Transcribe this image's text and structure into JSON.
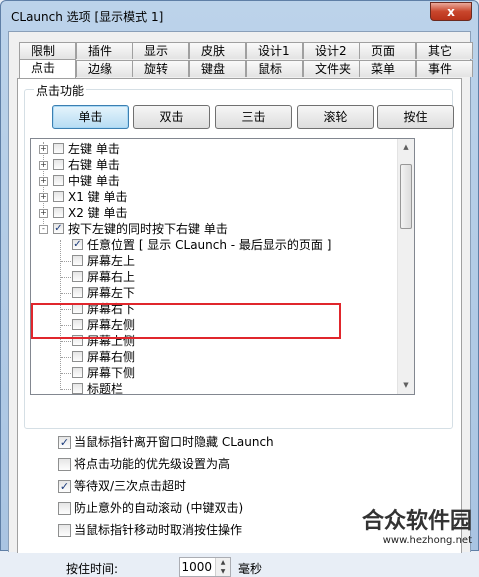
{
  "window": {
    "title": "CLaunch 选项 [显示模式 1]",
    "close_label": "x"
  },
  "tabs_row1": [
    "限制",
    "插件",
    "显示",
    "皮肤",
    "设计1",
    "设计2",
    "页面",
    "其它"
  ],
  "tabs_row2": [
    "点击",
    "边缘",
    "旋转",
    "键盘",
    "鼠标",
    "文件夹",
    "菜单",
    "事件"
  ],
  "active_tab": "点击",
  "group": {
    "label": "点击功能",
    "buttons": [
      "单击",
      "双击",
      "三击",
      "滚轮",
      "按住"
    ],
    "selected_button": "单击"
  },
  "tree": {
    "items": [
      {
        "label": "左键 单击",
        "checked": false,
        "expander": "+"
      },
      {
        "label": "右键 单击",
        "checked": false,
        "expander": "+"
      },
      {
        "label": "中键 单击",
        "checked": false,
        "expander": "+"
      },
      {
        "label": "X1 键 单击",
        "checked": false,
        "expander": "+"
      },
      {
        "label": "X2 键 单击",
        "checked": false,
        "expander": "+"
      },
      {
        "label": "按下左键的同时按下右键 单击",
        "checked": true,
        "expander": "-"
      }
    ],
    "sub_selected": {
      "label": "任意位置 [ 显示 CLaunch - 最后显示的页面 ]",
      "checked": true
    },
    "sub_items": [
      "屏幕左上",
      "屏幕右上",
      "屏幕左下",
      "屏幕右下",
      "屏幕左侧",
      "屏幕上侧",
      "屏幕右侧",
      "屏幕下侧",
      "标题栏"
    ]
  },
  "options": [
    {
      "label": "当鼠标指针离开窗口时隐藏 CLaunch",
      "checked": true
    },
    {
      "label": "将点击功能的优先级设置为高",
      "checked": false
    },
    {
      "label": "等待双/三次点击超时",
      "checked": true
    },
    {
      "label": "防止意外的自动滚动 (中键双击)",
      "checked": false
    },
    {
      "label": "当鼠标指针移动时取消按住操作",
      "checked": false
    }
  ],
  "hold_time": {
    "label": "按住时间:",
    "value": "1000",
    "unit": "毫秒"
  },
  "watermark": {
    "name": "合众软件园",
    "url": "www.hezhong.net"
  }
}
